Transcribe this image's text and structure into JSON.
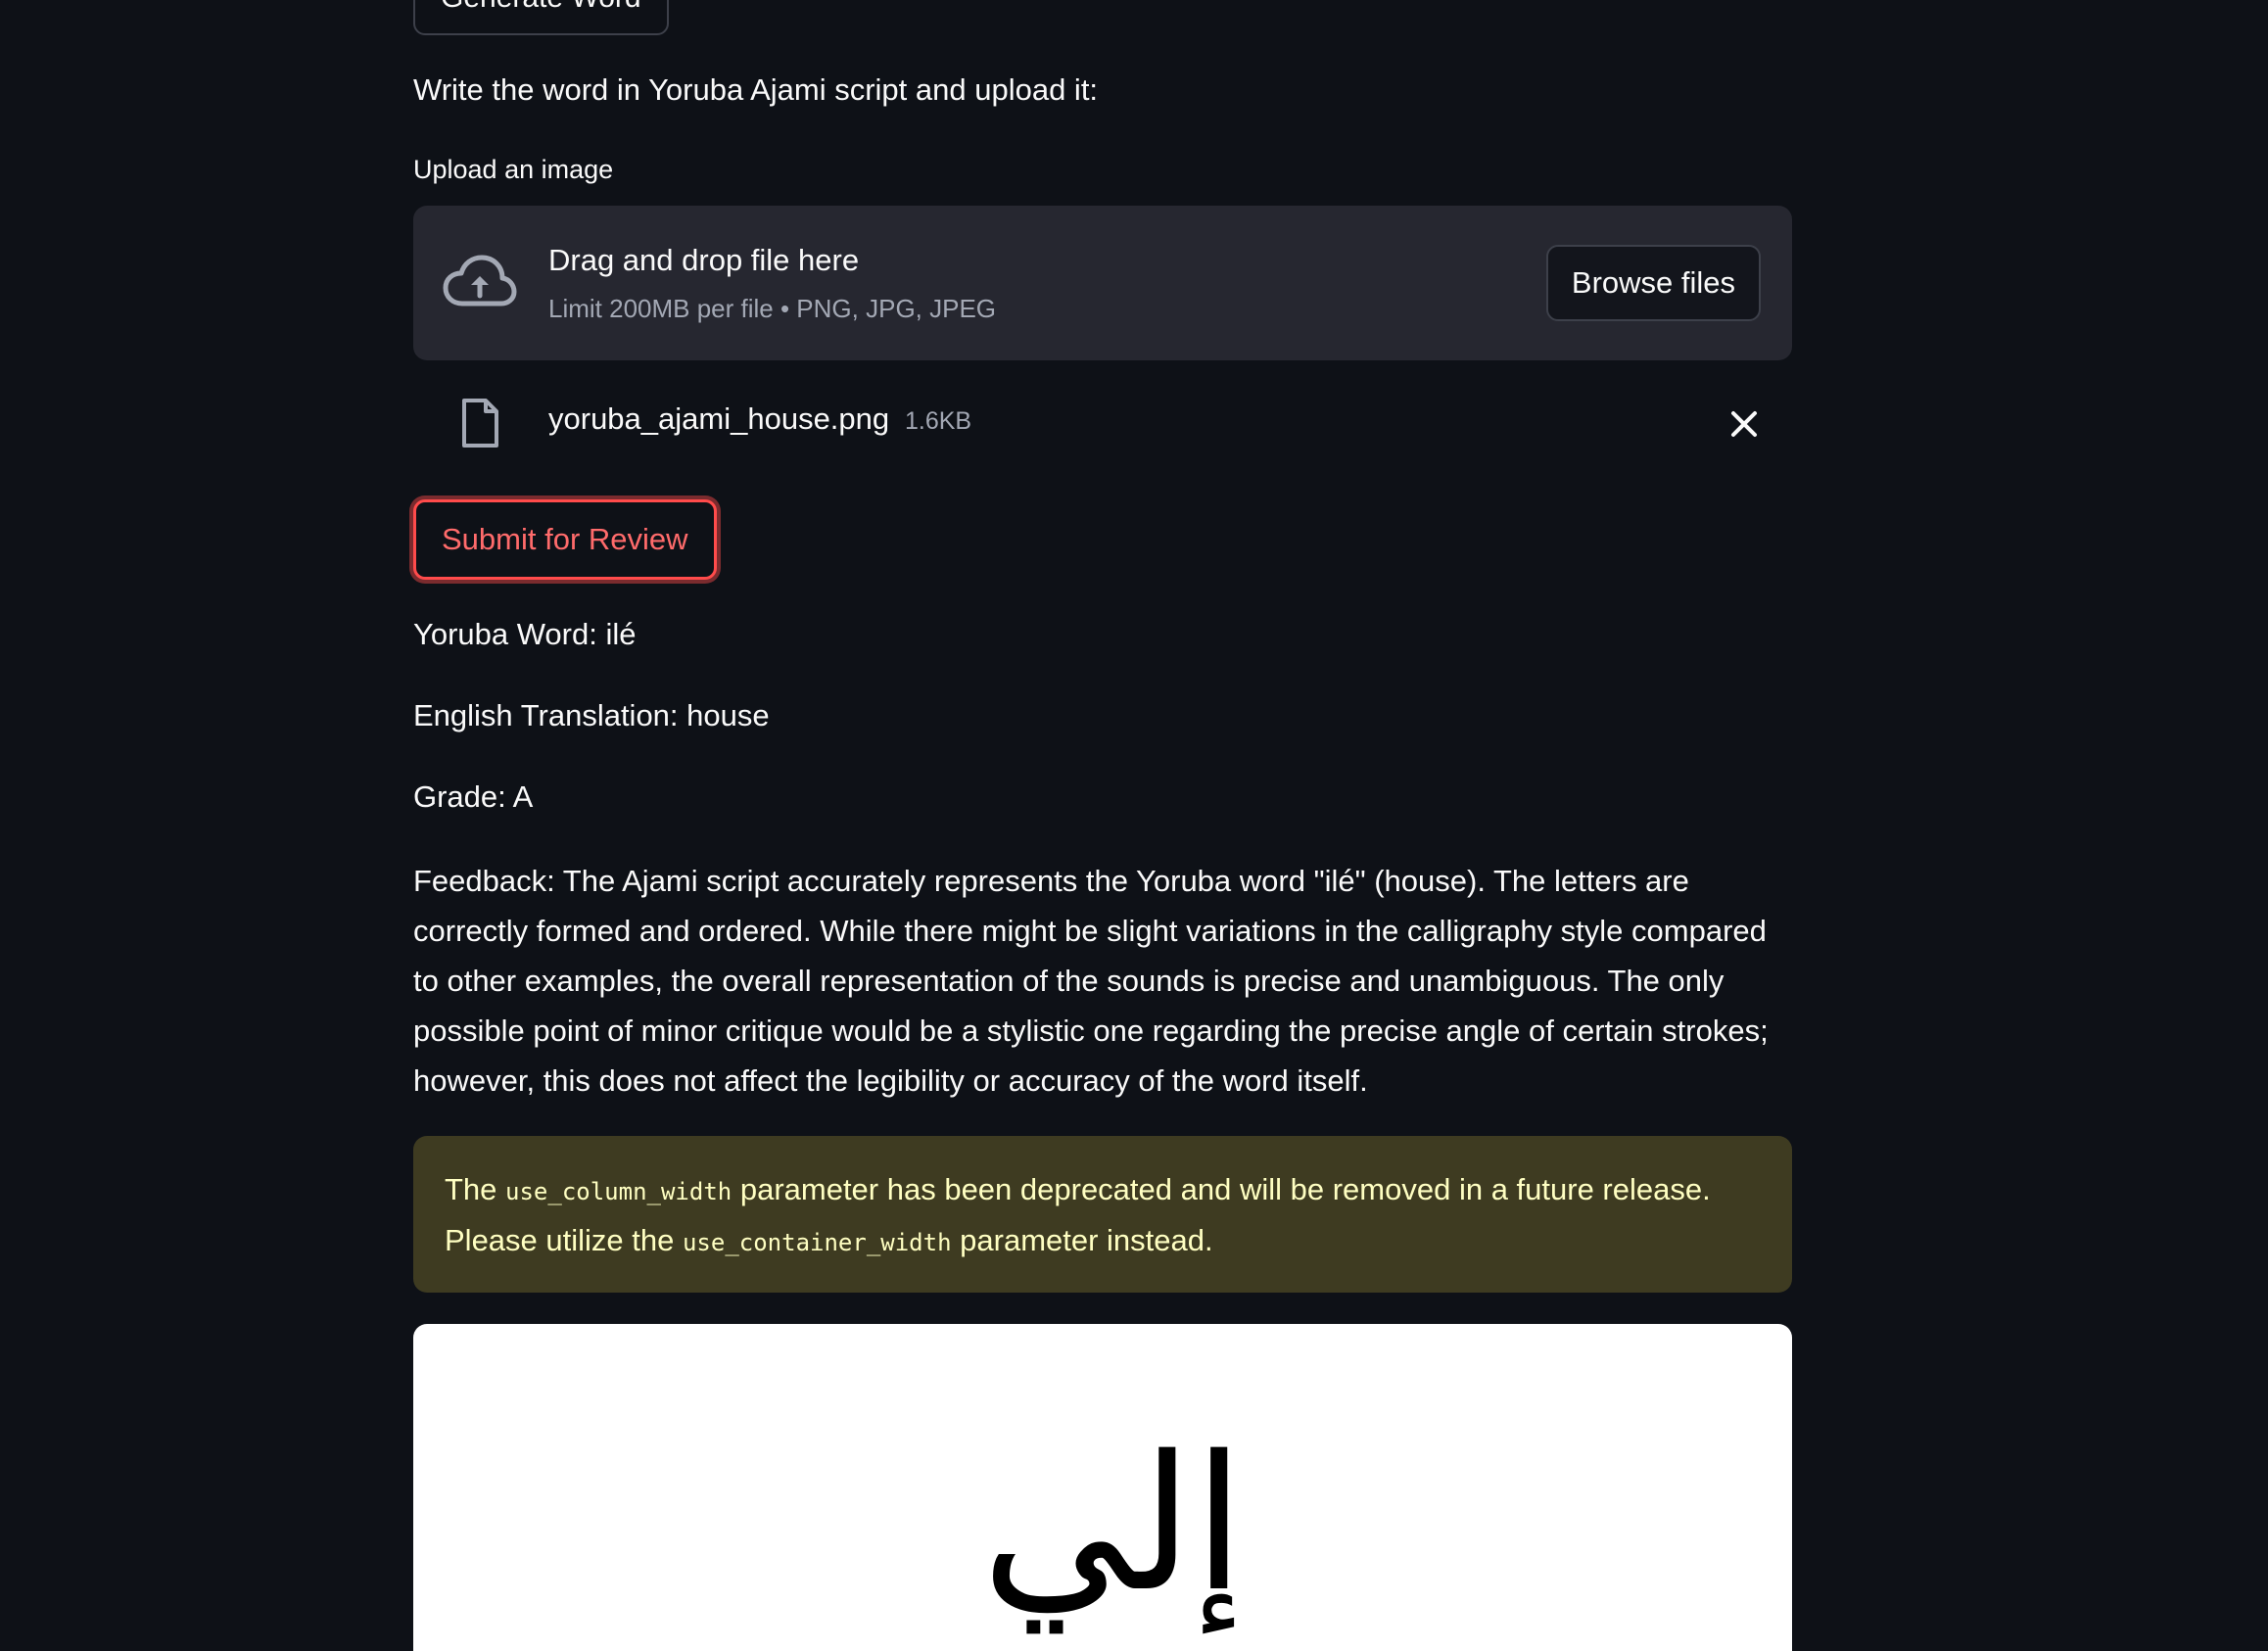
{
  "top_button": {
    "label": "Generate Word"
  },
  "instruction": "Write the word in Yoruba Ajami script and upload it:",
  "uploader": {
    "label": "Upload an image",
    "title": "Drag and drop file here",
    "limit": "Limit 200MB per file • PNG, JPG, JPEG",
    "browse_label": "Browse files"
  },
  "uploaded_file": {
    "name": "yoruba_ajami_house.png",
    "size": "1.6KB"
  },
  "submit": {
    "label": "Submit for Review"
  },
  "result": {
    "word": "Yoruba Word: ilé",
    "translation": "English Translation: house",
    "grade": "Grade: A",
    "feedback": "Feedback: The Ajami script accurately represents the Yoruba word \"ilé\" (house). The letters are correctly formed and ordered. While there might be slight variations in the calligraphy style compared to other examples, the overall representation of the sounds is precise and unambiguous. The only possible point of minor critique would be a stylistic one regarding the precise angle of certain strokes; however, this does not affect the legibility or accuracy of the word itself."
  },
  "warning": {
    "part1": "The ",
    "code1": "use_column_width",
    "part2": " parameter has been deprecated and will be removed in a future release. Please utilize the ",
    "code2": "use_container_width",
    "part3": " parameter instead."
  },
  "image_text": "إلي",
  "colors": {
    "background": "#0e1117",
    "surface": "#262730",
    "accent": "#ff4b4b",
    "warning_bg": "#3e3b21",
    "warning_text": "#ffffc2"
  },
  "icons": [
    "cloud-upload-icon",
    "file-icon",
    "close-icon"
  ]
}
